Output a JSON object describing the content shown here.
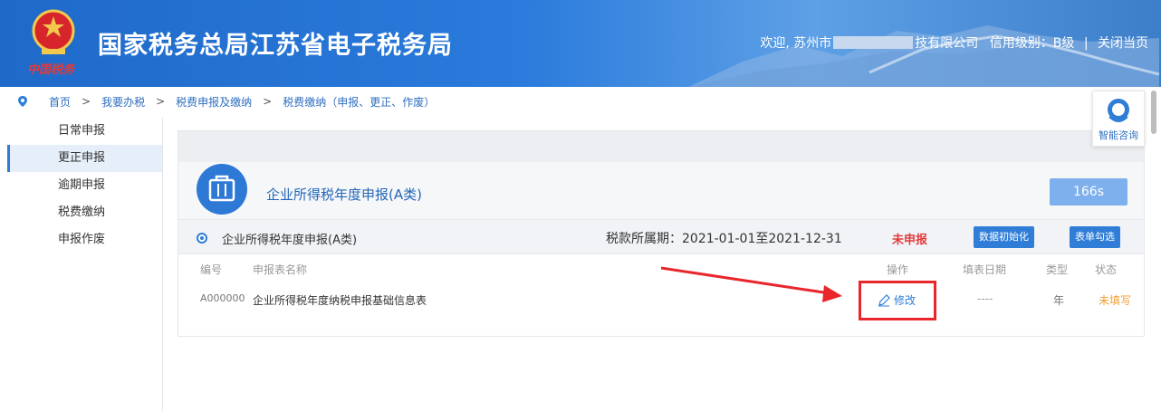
{
  "header": {
    "site_title": "国家税务总局江苏省电子税务局",
    "emblem_text": "中国税务",
    "welcome_prefix": "欢迎, 苏州市",
    "welcome_suffix": "技有限公司",
    "credit_label": "信用级别：B级",
    "close_label": "关闭当页",
    "separator": "|"
  },
  "breadcrumb": {
    "items": [
      "首页",
      "我要办税",
      "税费申报及缴纳",
      "税费缴纳（申报、更正、作废）"
    ],
    "arrow": ">"
  },
  "sidebar": {
    "items": [
      {
        "label": "日常申报",
        "active": false
      },
      {
        "label": "更正申报",
        "active": true
      },
      {
        "label": "逾期申报",
        "active": false
      },
      {
        "label": "税费缴纳",
        "active": false
      },
      {
        "label": "申报作废",
        "active": false
      }
    ]
  },
  "help": {
    "label": "智能咨询"
  },
  "form": {
    "title": "企业所得税年度申报(A类)",
    "timer": "166s",
    "row": {
      "name": "企业所得税年度申报(A类)",
      "period": "税款所属期：2021-01-01至2021-12-31",
      "status": "未申报",
      "init_button": "数据初始化",
      "check_button": "表单勾选"
    },
    "table": {
      "headers": {
        "no": "编号",
        "name": "申报表名称",
        "op": "操作",
        "date": "填表日期",
        "type": "类型",
        "status": "状态"
      },
      "rows": [
        {
          "no": "A000000",
          "name": "企业所得税年度纳税申报基础信息表",
          "op": "修改",
          "date": "----",
          "type": "年",
          "status": "未填写"
        }
      ]
    }
  },
  "colors": {
    "header_blue": "#1f69c9",
    "accent_blue": "#2f7dd6",
    "annotation_red": "#e8262b",
    "status_red": "#e23b3b",
    "status_orange": "#f0a030"
  }
}
